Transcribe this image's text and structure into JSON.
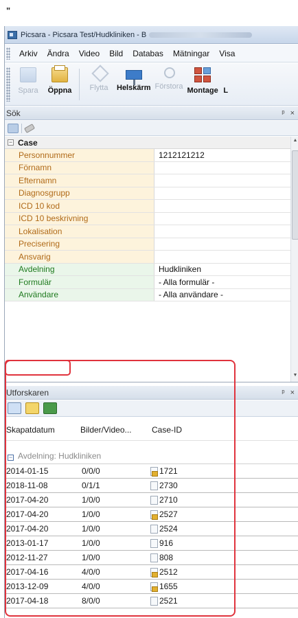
{
  "decor": {
    "quote_mark": "\""
  },
  "window": {
    "title": "Picsara - Picsara Test/Hudkliniken - B"
  },
  "menu": [
    "Arkiv",
    "Ändra",
    "Video",
    "Bild",
    "Databas",
    "Mätningar",
    "Visa"
  ],
  "toolbar": {
    "buttons": [
      {
        "label": "Spara",
        "icon": "save-icon",
        "enabled": false
      },
      {
        "label": "Öppna",
        "icon": "open-folder-icon",
        "enabled": true
      },
      {
        "label": "Flytta",
        "icon": "move-icon",
        "enabled": false
      },
      {
        "label": "Helskärm",
        "icon": "fullscreen-icon",
        "enabled": true
      },
      {
        "label": "Förstora",
        "icon": "zoom-icon",
        "enabled": false
      },
      {
        "label": "Montage",
        "icon": "montage-icon",
        "enabled": true
      },
      {
        "label": "L",
        "icon": "",
        "enabled": true
      }
    ]
  },
  "search_panel": {
    "title": "Sök",
    "pin": "ᵖ",
    "close": "×",
    "category": "Case",
    "properties": [
      {
        "name": "Personnummer",
        "value": "1212121212",
        "color": "orange"
      },
      {
        "name": "Förnamn",
        "value": "",
        "color": "orange"
      },
      {
        "name": "Efternamn",
        "value": "",
        "color": "orange"
      },
      {
        "name": "Diagnosgrupp",
        "value": "",
        "color": "orange"
      },
      {
        "name": "ICD 10 kod",
        "value": "",
        "color": "orange"
      },
      {
        "name": "ICD 10 beskrivning",
        "value": "",
        "color": "orange"
      },
      {
        "name": "Lokalisation",
        "value": "",
        "color": "orange"
      },
      {
        "name": "Precisering",
        "value": "",
        "color": "orange"
      },
      {
        "name": "Ansvarig",
        "value": "",
        "color": "orange"
      },
      {
        "name": "Avdelning",
        "value": "Hudkliniken",
        "color": "green"
      },
      {
        "name": "Formulär",
        "value": "- Alla formulär -",
        "color": "green"
      },
      {
        "name": "Användare",
        "value": "- Alla användare -",
        "color": "green"
      }
    ]
  },
  "explorer": {
    "title": "Utforskaren",
    "pin": "ᵖ",
    "close": "×",
    "columns": [
      "Skapatdatum",
      "Bilder/Video...",
      "Case-ID"
    ],
    "group_label": "Avdelning: Hudkliniken",
    "rows": [
      {
        "date": "2014-01-15",
        "media": "0/0/0",
        "case_id": "1721",
        "locked": true
      },
      {
        "date": "2018-11-08",
        "media": "0/1/1",
        "case_id": "2730",
        "locked": false
      },
      {
        "date": "2017-04-20",
        "media": "1/0/0",
        "case_id": "2710",
        "locked": false
      },
      {
        "date": "2017-04-20",
        "media": "1/0/0",
        "case_id": "2527",
        "locked": true
      },
      {
        "date": "2017-04-20",
        "media": "1/0/0",
        "case_id": "2524",
        "locked": false
      },
      {
        "date": "2013-01-17",
        "media": "1/0/0",
        "case_id": "916",
        "locked": false
      },
      {
        "date": "2012-11-27",
        "media": "1/0/0",
        "case_id": "808",
        "locked": false
      },
      {
        "date": "2017-04-16",
        "media": "4/0/0",
        "case_id": "2512",
        "locked": true
      },
      {
        "date": "2013-12-09",
        "media": "4/0/0",
        "case_id": "1655",
        "locked": true
      },
      {
        "date": "2017-04-18",
        "media": "8/0/0",
        "case_id": "2521",
        "locked": false
      }
    ]
  },
  "colors": {
    "highlight": "#e0323c",
    "accent": "#3d7cc9"
  }
}
